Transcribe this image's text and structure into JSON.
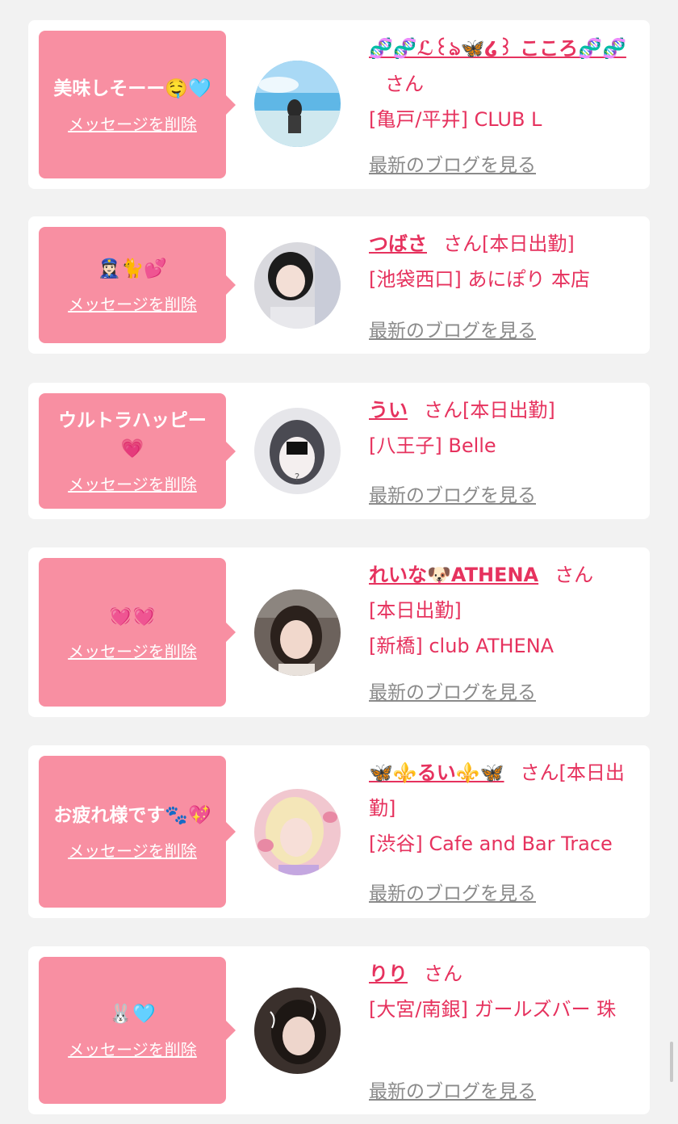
{
  "labels": {
    "san": "さん",
    "delete_message": "メッセージを削除",
    "latest_blog": "最新のブログを見る"
  },
  "cards": [
    {
      "message": "美味しそーー🤤🩵",
      "name": "🧬🧬ℒ꒰ঌ🦋໒꒱ こころ🧬🧬",
      "status": "",
      "store": "[亀戸/平井] CLUB L"
    },
    {
      "message": "👮🏻‍♀️🐈💕",
      "name": "つばさ",
      "status": "[本日出勤]",
      "store": "[池袋西口] あにぽり 本店"
    },
    {
      "message": "ウルトラハッピー💗",
      "name": "うい",
      "status": "[本日出勤]",
      "store": "[八王子] Belle"
    },
    {
      "message": "💓💓",
      "name": "れいな🐶ATHENA",
      "status": "[本日出勤]",
      "store": "[新橋] club ATHENA"
    },
    {
      "message": "お疲れ様です🐾💖",
      "name": "🦋⚜️るい⚜️🦋",
      "status": "[本日出勤]",
      "store": "[渋谷] Cafe and Bar Trace"
    },
    {
      "message": "🐰🩵",
      "name": "りり",
      "status": "",
      "store": "[大宮/南銀] ガールズバー 珠"
    }
  ]
}
